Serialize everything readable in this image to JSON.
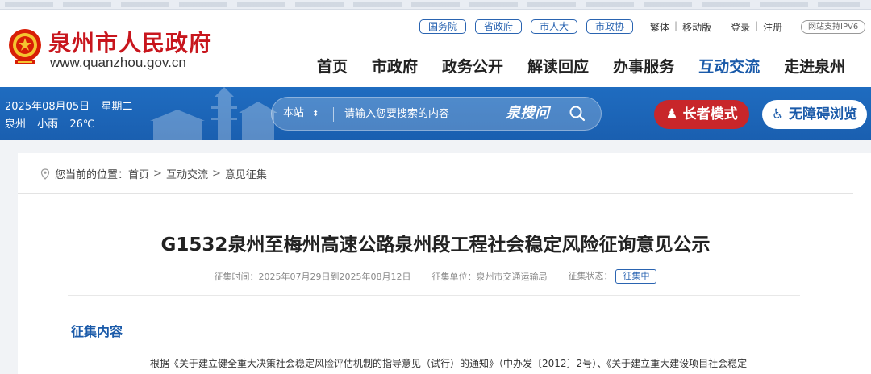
{
  "header": {
    "site_name": "泉州市人民政府",
    "site_url": "www.quanzhou.gov.cn",
    "top_links": [
      "国务院",
      "省政府",
      "市人大",
      "市政协"
    ],
    "utils": {
      "traditional": "繁体",
      "mobile": "移动版",
      "login": "登录",
      "register": "注册",
      "sep": "|"
    },
    "ipv6": "网站支持IPV6",
    "nav": [
      "首页",
      "市政府",
      "政务公开",
      "解读回应",
      "办事服务",
      "互动交流",
      "走进泉州"
    ],
    "active_nav": "互动交流",
    "colors": {
      "brand_red": "#c8161d",
      "nav_active": "#1a5aa9"
    }
  },
  "band": {
    "date": "2025年08月05日",
    "weekday": "星期二",
    "city": "泉州",
    "weather": "小雨",
    "temperature": "26℃",
    "search": {
      "scope": "本站",
      "placeholder": "请输入您要搜索的内容",
      "brand": "泉搜问"
    },
    "elder_mode": "长者模式",
    "accessible": "无障碍浏览",
    "colors": {
      "band": "#1f6cc0",
      "elder": "#c8262a"
    }
  },
  "breadcrumb": {
    "prefix": "您当前的位置：",
    "items": [
      "首页",
      "互动交流",
      "意见征集"
    ],
    "sep": ">"
  },
  "article": {
    "title": "G1532泉州至梅州高速公路泉州段工程社会稳定风险征询意见公示",
    "period_label": "征集时间：",
    "period": "2025年07月29日到2025年08月12日",
    "unit_label": "征集单位：",
    "unit": "泉州市交通运输局",
    "status_label": "征集状态：",
    "status": "征集中",
    "section_title": "征集内容",
    "paragraph": "根据《关于建立健全重大决策社会稳定风险评估机制的指导意见（试行）的通知》（中办发〔2012〕2号）、《关于建立重大建设项目社会稳定"
  }
}
